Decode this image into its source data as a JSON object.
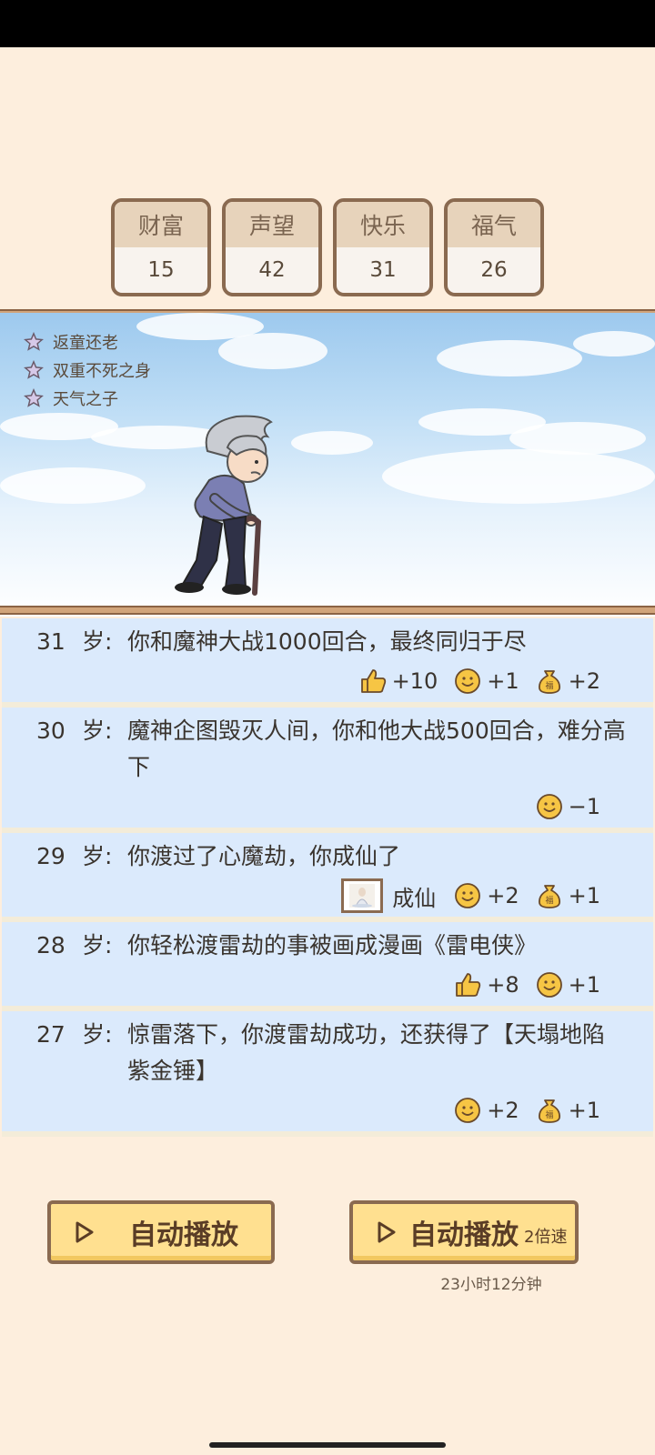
{
  "stats": [
    {
      "label": "财富",
      "value": "15"
    },
    {
      "label": "声望",
      "value": "42"
    },
    {
      "label": "快乐",
      "value": "31"
    },
    {
      "label": "福气",
      "value": "26"
    }
  ],
  "traits": [
    {
      "label": "返童还老",
      "icon": "star-icon"
    },
    {
      "label": "双重不死之身",
      "icon": "star-icon"
    },
    {
      "label": "天气之子",
      "icon": "star-icon"
    }
  ],
  "log": [
    {
      "age": "31",
      "unit": "岁:",
      "text": "你和魔神大战1000回合，最终同归于尽",
      "effects": [
        {
          "icon": "thumbs-up-icon",
          "value": "+10"
        },
        {
          "icon": "smiley-icon",
          "value": "+1"
        },
        {
          "icon": "money-bag-icon",
          "value": "+2"
        }
      ]
    },
    {
      "age": "30",
      "unit": "岁:",
      "text": "魔神企图毁灭人间，你和他大战500回合，难分高下",
      "effects": [
        {
          "icon": "smiley-icon",
          "value": "−1"
        }
      ]
    },
    {
      "age": "29",
      "unit": "岁:",
      "text": "你渡过了心魔劫，你成仙了",
      "badge": "成仙",
      "effects": [
        {
          "icon": "smiley-icon",
          "value": "+2"
        },
        {
          "icon": "money-bag-icon",
          "value": "+1"
        }
      ]
    },
    {
      "age": "28",
      "unit": "岁:",
      "text": "你轻松渡雷劫的事被画成漫画《雷电侠》",
      "effects": [
        {
          "icon": "thumbs-up-icon",
          "value": "+8"
        },
        {
          "icon": "smiley-icon",
          "value": "+1"
        }
      ]
    },
    {
      "age": "27",
      "unit": "岁:",
      "text": "惊雷落下，你渡雷劫成功，还获得了【天塌地陷紫金锤】",
      "effects": [
        {
          "icon": "smiley-icon",
          "value": "+2"
        },
        {
          "icon": "money-bag-icon",
          "value": "+1"
        }
      ]
    }
  ],
  "buttons": {
    "auto_play": "自动播放",
    "auto_play_fast": "自动播放",
    "speed": "2倍速",
    "timer": "23小时12分钟"
  },
  "money_bag_char": "福",
  "colors": {
    "background": "#fdeedd",
    "card_border": "#8a6a50",
    "log_entry": "#dbeafc",
    "button_fill": "#ffe090",
    "icon_yellow": "#f6c544"
  }
}
